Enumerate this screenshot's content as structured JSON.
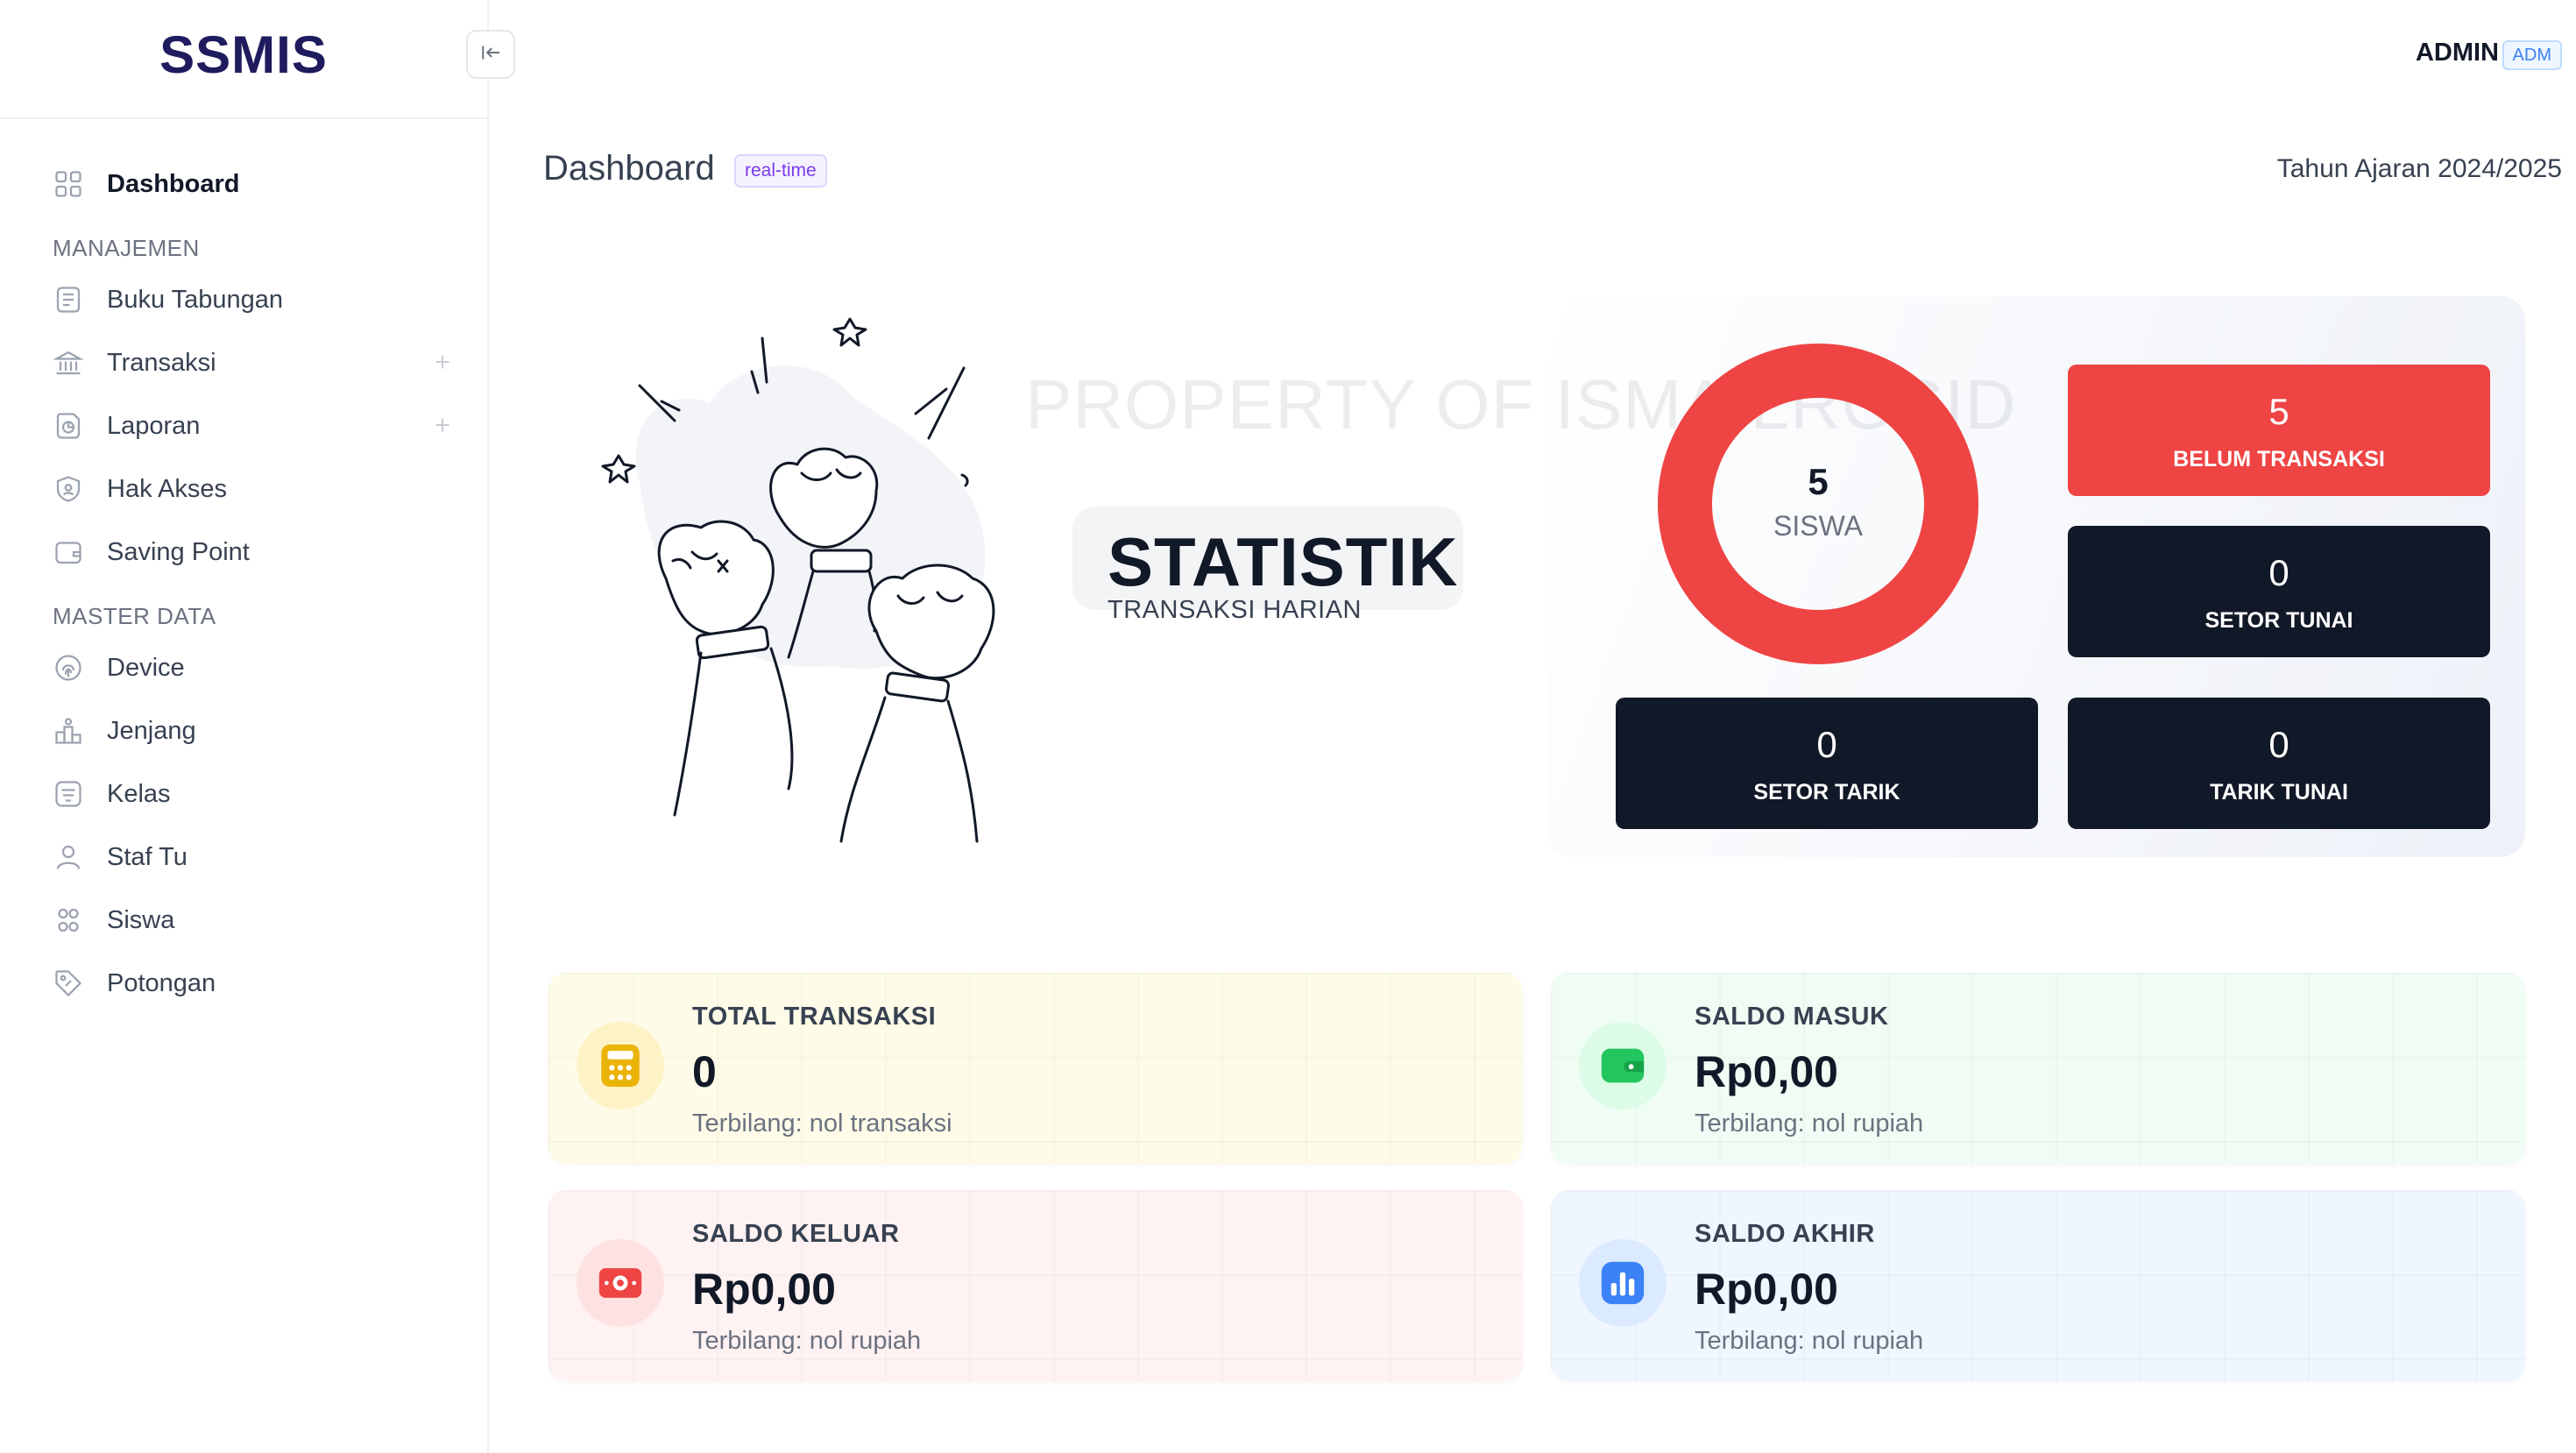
{
  "app": {
    "name": "SSMIS"
  },
  "sidebar": {
    "dashboard": "Dashboard",
    "section_manajemen": "MANAJEMEN",
    "buku_tabungan": "Buku Tabungan",
    "transaksi": "Transaksi",
    "laporan": "Laporan",
    "hak_akses": "Hak Akses",
    "saving_point": "Saving Point",
    "section_master": "MASTER DATA",
    "device": "Device",
    "jenjang": "Jenjang",
    "kelas": "Kelas",
    "staf_tu": "Staf Tu",
    "siswa": "Siswa",
    "potongan": "Potongan"
  },
  "header": {
    "user": "ADMIN",
    "role_badge": "ADM"
  },
  "page": {
    "title": "Dashboard",
    "badge": "real-time",
    "academic_year": "Tahun Ajaran 2024/2025"
  },
  "hero": {
    "title": "STATISTIK",
    "subtitle": "TRANSAKSI HARIAN",
    "watermark": "PROPERTY OF ISMAILROSID"
  },
  "stats": {
    "donut_value": "5",
    "donut_label": "SISWA",
    "donut_color": "#ef4444",
    "belum_transaksi": {
      "value": "5",
      "label": "BELUM TRANSAKSI"
    },
    "setor_tunai": {
      "value": "0",
      "label": "SETOR TUNAI"
    },
    "setor_tarik": {
      "value": "0",
      "label": "SETOR TARIK"
    },
    "tarik_tunai": {
      "value": "0",
      "label": "TARIK TUNAI"
    }
  },
  "cards": {
    "total_transaksi": {
      "title": "TOTAL TRANSAKSI",
      "value": "0",
      "sub": "Terbilang: nol transaksi",
      "icon": "calculator-icon",
      "color": "#eab308"
    },
    "saldo_masuk": {
      "title": "SALDO MASUK",
      "value": "Rp0,00",
      "sub": "Terbilang: nol rupiah",
      "icon": "wallet-icon",
      "color": "#22c55e"
    },
    "saldo_keluar": {
      "title": "SALDO KELUAR",
      "value": "Rp0,00",
      "sub": "Terbilang: nol rupiah",
      "icon": "money-icon",
      "color": "#ef4444"
    },
    "saldo_akhir": {
      "title": "SALDO AKHIR",
      "value": "Rp0,00",
      "sub": "Terbilang: nol rupiah",
      "icon": "bar-chart-icon",
      "color": "#3b82f6"
    }
  }
}
